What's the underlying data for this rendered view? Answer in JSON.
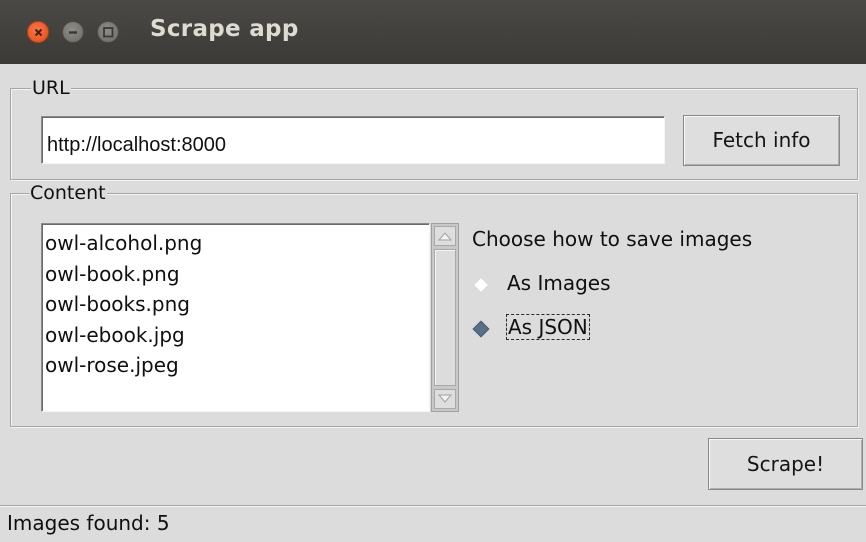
{
  "window": {
    "title": "Scrape app",
    "controls": {
      "close_icon": "close-icon",
      "minimize_icon": "minimize-icon",
      "maximize_icon": "maximize-icon"
    }
  },
  "url_group": {
    "label": "URL",
    "url_value": "http://localhost:8000",
    "fetch_button": "Fetch info"
  },
  "content_group": {
    "label": "Content",
    "files": [
      "owl-alcohol.png",
      "owl-book.png",
      "owl-books.png",
      "owl-ebook.jpg",
      "owl-rose.jpeg"
    ],
    "save_heading": "Choose how to save images",
    "save_options": [
      {
        "label": "As Images",
        "selected": false
      },
      {
        "label": "As JSON",
        "selected": true
      }
    ]
  },
  "scrape_button": "Scrape!",
  "status_text": "Images found: 5",
  "colors": {
    "titlebar": "#3c3b37",
    "close_button": "#e9571f",
    "window_bg": "#dcdcdc",
    "radio_selected": "#5a6e87"
  }
}
